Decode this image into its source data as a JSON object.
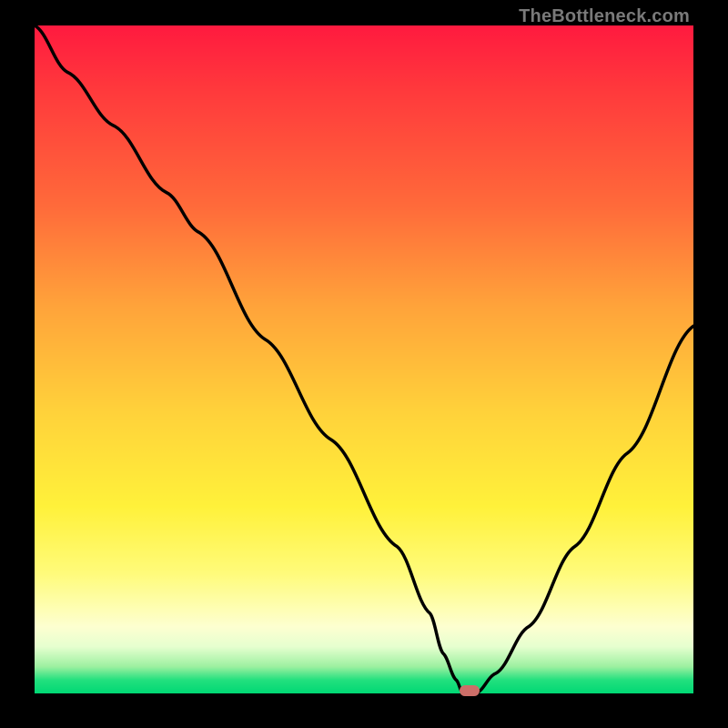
{
  "watermark": {
    "text": "TheBottleneck.com"
  },
  "colors": {
    "background": "#000000",
    "gradient_stops": [
      "#ff1a3f",
      "#ff6a3a",
      "#ffd23a",
      "#fffb7a",
      "#00d874"
    ],
    "curve": "#000000",
    "marker": "#cc6e68"
  },
  "chart_data": {
    "type": "line",
    "title": "",
    "xlabel": "",
    "ylabel": "",
    "xlim": [
      0,
      100
    ],
    "ylim": [
      0,
      100
    ],
    "background": "vertical gradient red→green indicating bottleneck severity (red high, green low)",
    "series": [
      {
        "name": "bottleneck-curve",
        "x": [
          0,
          5,
          12,
          20,
          25,
          35,
          45,
          55,
          60,
          62,
          64,
          65,
          67,
          70,
          75,
          82,
          90,
          100
        ],
        "y": [
          100,
          93,
          85,
          75,
          69,
          53,
          38,
          22,
          12,
          6,
          2,
          0,
          0,
          3,
          10,
          22,
          36,
          55
        ]
      }
    ],
    "marker": {
      "x": 66,
      "y": 0,
      "label": "optimal-point"
    },
    "notes": "No axis tick labels are rendered. Curve shape approximates a steep descending V with minimum near x≈65 and a shallower rise to ~55% at the right edge."
  }
}
